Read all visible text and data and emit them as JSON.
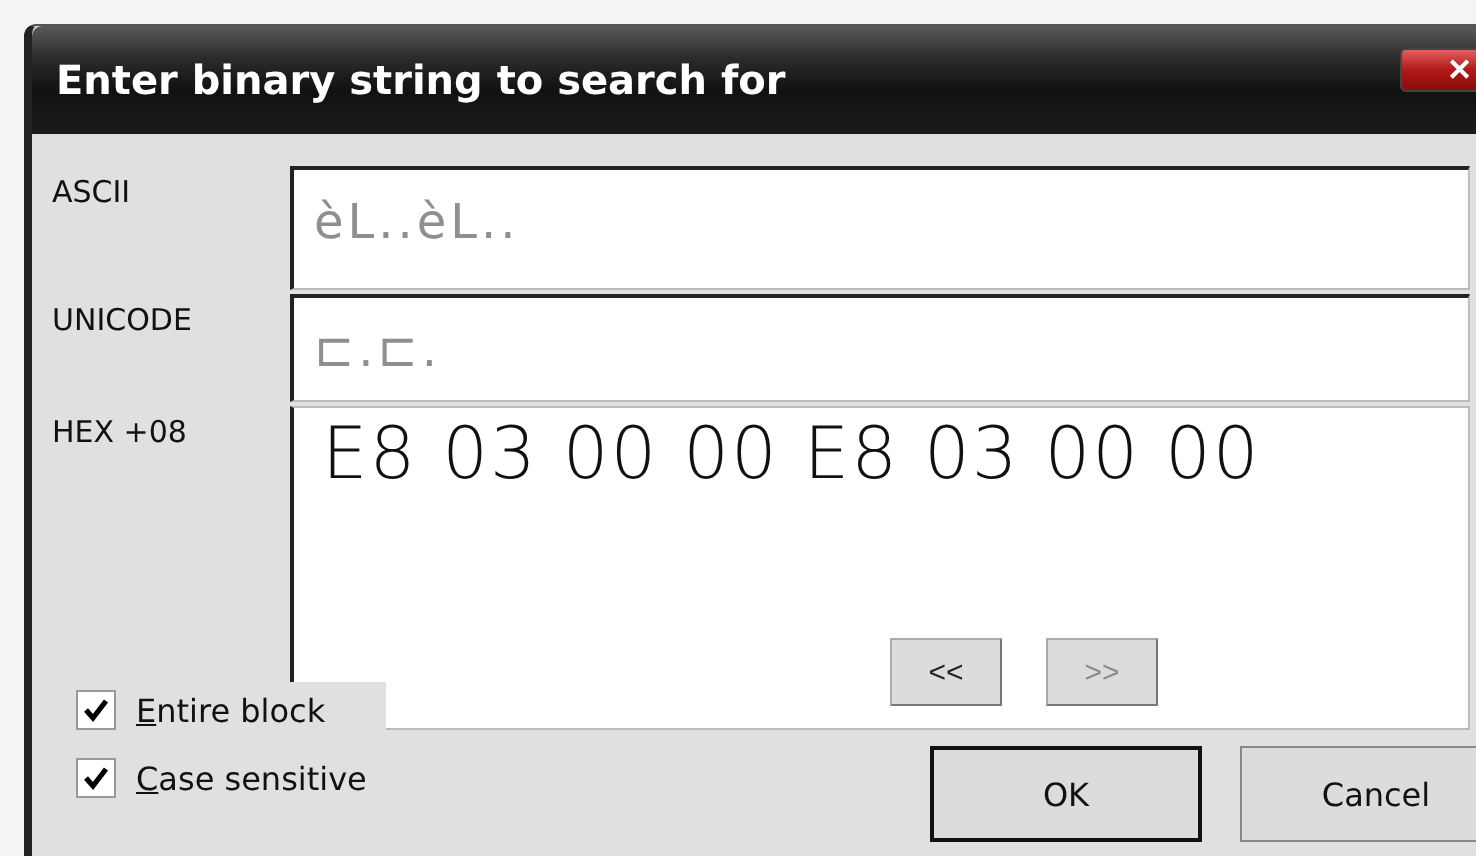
{
  "window": {
    "title": "Enter binary string to search for",
    "close": "✕"
  },
  "fields": [
    {
      "label": "ASCII",
      "value": "èL..èL..",
      "kind": "small"
    },
    {
      "label": "UNICODE",
      "value": "⊏.⊏.",
      "kind": "small"
    },
    {
      "label": "HEX +08",
      "value": "E8 03 00 00 E8 03 00 00",
      "kind": "large"
    }
  ],
  "nav_buttons": [
    {
      "label": "<<",
      "disabled": false
    },
    {
      "label": ">>",
      "disabled": true
    }
  ],
  "checkboxes": [
    {
      "label": "Entire block",
      "checked": true,
      "focused": true
    },
    {
      "label": "Case sensitive",
      "checked": true,
      "focused": false
    }
  ],
  "buttons": [
    {
      "label": "OK",
      "default": true
    },
    {
      "label": "Cancel",
      "default": false
    }
  ]
}
